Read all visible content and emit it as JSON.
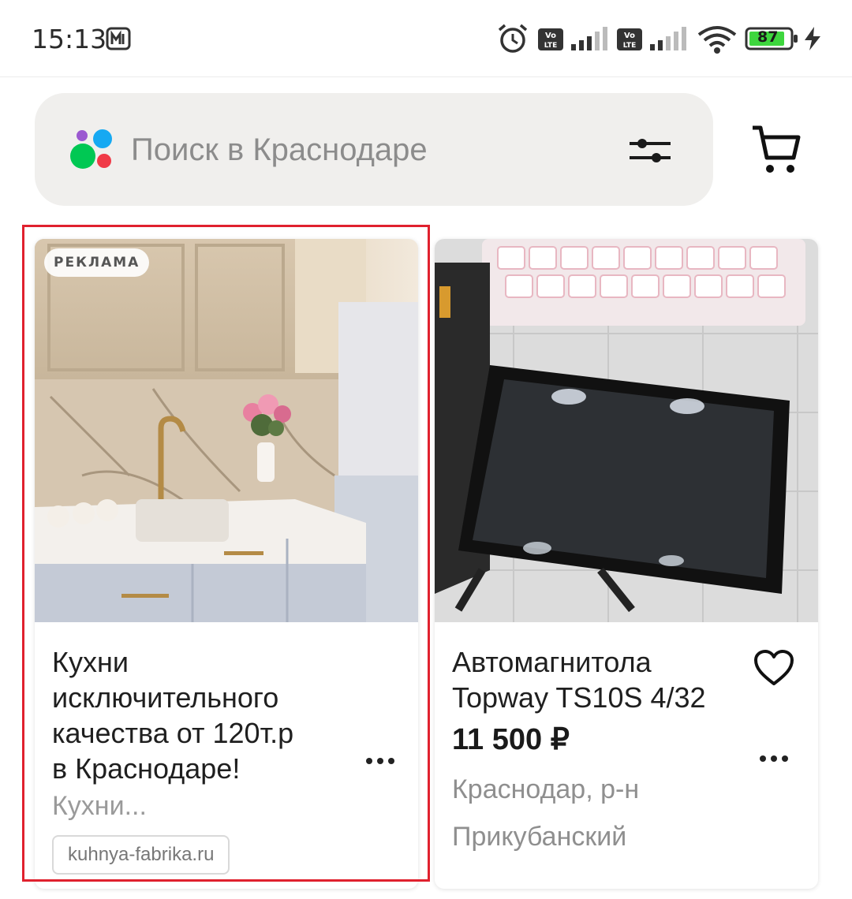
{
  "status_bar": {
    "time": "15:13",
    "battery": "87",
    "icons": [
      "carrier-m-icon",
      "alarm-icon",
      "volte-icon",
      "signal-icon",
      "volte-icon",
      "signal-icon",
      "wifi-icon",
      "battery-icon",
      "charging-icon"
    ]
  },
  "search": {
    "placeholder": "Поиск в Краснодаре",
    "logo_icon": "avito-logo-icon",
    "filter_icon": "filter-sliders-icon"
  },
  "cart_icon": "cart-icon",
  "cards": [
    {
      "badge": "РЕКЛАМА",
      "title_lines": [
        "Кухни",
        "исключительного",
        "качества от 120т.р",
        "в Краснодаре!"
      ],
      "subtitle": "Кухни...",
      "url": "kuhnya-fabrika.ru",
      "image": "kitchen-photo",
      "more_icon": "more-dots-icon"
    },
    {
      "title_lines": [
        "Автомагнитола",
        "Topway TS10S 4/32"
      ],
      "price": "11 500 ₽",
      "location_lines": [
        "Краснодар, р-н",
        "Прикубанский"
      ],
      "image": "car-radio-photo",
      "favorite_icon": "heart-icon",
      "more_icon": "more-dots-icon"
    }
  ],
  "colors": {
    "highlight": "#e0212e",
    "search_bg": "#f0efed",
    "logo_purple": "#9b59d0",
    "logo_blue": "#16a9f2",
    "logo_green": "#00c853",
    "logo_red": "#f03a47",
    "battery_green": "#3ed63e"
  }
}
